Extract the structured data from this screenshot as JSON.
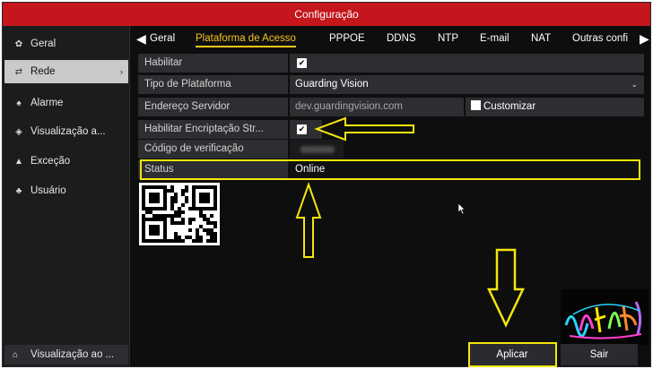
{
  "window": {
    "title": "Configuração"
  },
  "sidebar": {
    "items": [
      {
        "label": "Geral",
        "icon": "gear-icon",
        "glyph": "✿"
      },
      {
        "label": "Rede",
        "icon": "network-icon",
        "glyph": "⇄",
        "chevron": "›"
      },
      {
        "label": "Alarme",
        "icon": "alarm-icon",
        "glyph": "♠"
      },
      {
        "label": "Visualização a...",
        "icon": "eye-icon",
        "glyph": "◈"
      },
      {
        "label": "Exceção",
        "icon": "warning-icon",
        "glyph": "▲"
      },
      {
        "label": "Usuário",
        "icon": "users-icon",
        "glyph": "♣"
      }
    ],
    "bottom": {
      "label": "Visualização ao ...",
      "icon": "home-icon",
      "glyph": "⌂"
    }
  },
  "tabs": {
    "prev_glyph": "◀",
    "next_glyph": "▶",
    "items": [
      "Geral",
      "Plataforma de Acesso",
      "PPPOE",
      "DDNS",
      "NTP",
      "E-mail",
      "NAT",
      "Outras confi"
    ]
  },
  "form": {
    "enable": {
      "label": "Habilitar",
      "checked": "✔"
    },
    "platform_type": {
      "label": "Tipo de Plataforma",
      "value": "Guarding Vision",
      "caret": "⌄"
    },
    "server_address": {
      "label": "Endereço Servidor",
      "value": "dev.guardingvision.com",
      "custom_label": "Customizar"
    },
    "stream_encryption": {
      "label": "Habilitar Encriptação Str...",
      "checked": "✔"
    },
    "verification_code": {
      "label": "Código de verificação"
    },
    "status": {
      "label": "Status",
      "value": "Online"
    }
  },
  "buttons": {
    "apply": "Aplicar",
    "exit": "Sair"
  },
  "colors": {
    "title_bar": "#c4161c",
    "active_tab": "#f5c518",
    "highlight": "#f5e60a"
  }
}
